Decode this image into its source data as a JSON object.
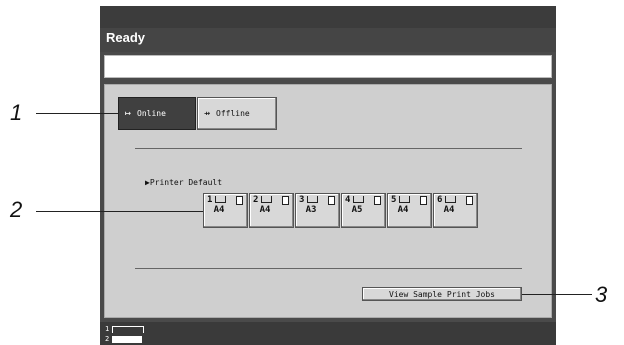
{
  "status": {
    "title": "Ready",
    "message": ""
  },
  "mode_buttons": [
    {
      "label": "Online",
      "icon": "online-arrow-icon",
      "selected": true
    },
    {
      "label": "Offline",
      "icon": "offline-arrow-icon",
      "selected": false
    }
  ],
  "printer_default": {
    "label": "▶Printer Default",
    "trays": [
      {
        "number": "1",
        "size": "A4"
      },
      {
        "number": "2",
        "size": "A4"
      },
      {
        "number": "3",
        "size": "A3"
      },
      {
        "number": "4",
        "size": "A5"
      },
      {
        "number": "5",
        "size": "A4"
      },
      {
        "number": "6",
        "size": "A4"
      }
    ]
  },
  "sample_button": {
    "label": "View Sample Print Jobs"
  },
  "tray_indicator": {
    "line1": "1",
    "line2": "2"
  },
  "callouts": [
    "1",
    "2",
    "3"
  ],
  "colors": {
    "frame": "#4a4a4a",
    "panel": "#cfcfcf",
    "selected": "#404040"
  }
}
